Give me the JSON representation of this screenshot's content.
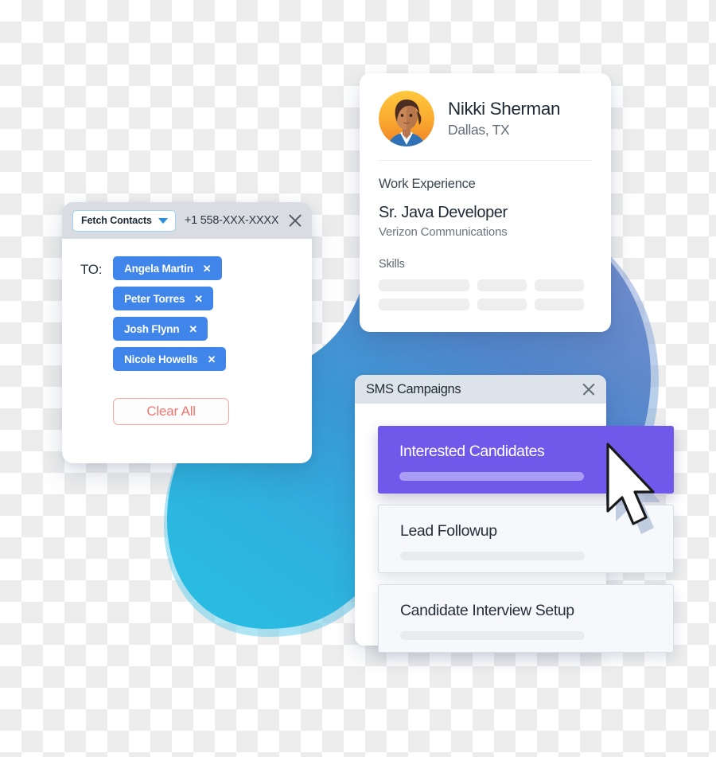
{
  "contacts_window": {
    "name": "Fetch Contacts window",
    "fetch_select_label": "Fetch Contacts",
    "chevron_icon": "chevron-down-icon",
    "phone_number": "+1 558-XXX-XXXX",
    "close_icon": "close-icon",
    "to_label": "TO:",
    "chips": [
      {
        "name": "Angela Martin",
        "remove_icon": "x-icon",
        "remove_label": "✕"
      },
      {
        "name": "Peter Torres",
        "remove_icon": "x-icon",
        "remove_label": "✕"
      },
      {
        "name": "Josh Flynn",
        "remove_icon": "x-icon",
        "remove_label": "✕"
      },
      {
        "name": "Nicole Howells",
        "remove_icon": "x-icon",
        "remove_label": "✕"
      }
    ],
    "clear_all_label": "Clear All",
    "colors": {
      "titlebar": "#d9dde2",
      "chip": "#3f85ea",
      "select_border": "#9ed2f0",
      "chevron": "#2b8ddb",
      "clear_all_text": "#f2756f",
      "clear_all_border": "#f9a3a0"
    }
  },
  "profile_card": {
    "avatar_icon": "avatar",
    "name": "Nikki Sherman",
    "location": "Dallas, TX",
    "work_experience_label": "Work Experience",
    "job_title": "Sr. Java Developer",
    "company": "Verizon Communications",
    "skills_label": "Skills",
    "skill_placeholders": 6,
    "colors": {
      "card": "#ffffff",
      "placeholder": "#eeeeee",
      "avatar_bg_start": "#ffc93c",
      "avatar_bg_end": "#f08a2a"
    }
  },
  "sms_window": {
    "title": "SMS Campaigns",
    "close_icon": "close-icon",
    "campaigns": [
      {
        "title": "Interested Candidates",
        "selected": true
      },
      {
        "title": "Lead Followup",
        "selected": false
      },
      {
        "title": "Candidate Interview Setup",
        "selected": false
      }
    ],
    "colors": {
      "titlebar": "#dde3ea",
      "selected": "#7059ea",
      "selected_bar": "#aa9df4",
      "card": "#f6f8fc",
      "card_border": "#d9dde4",
      "card_bar": "#e9ecef"
    }
  },
  "decor": {
    "blob_name": "blue-blob-background",
    "blob_gradient_start": "#5a7fc4",
    "blob_gradient_mid": "#3d9fd8",
    "blob_gradient_end": "#2bb7e0",
    "cursor_icon": "mouse-pointer-icon"
  }
}
